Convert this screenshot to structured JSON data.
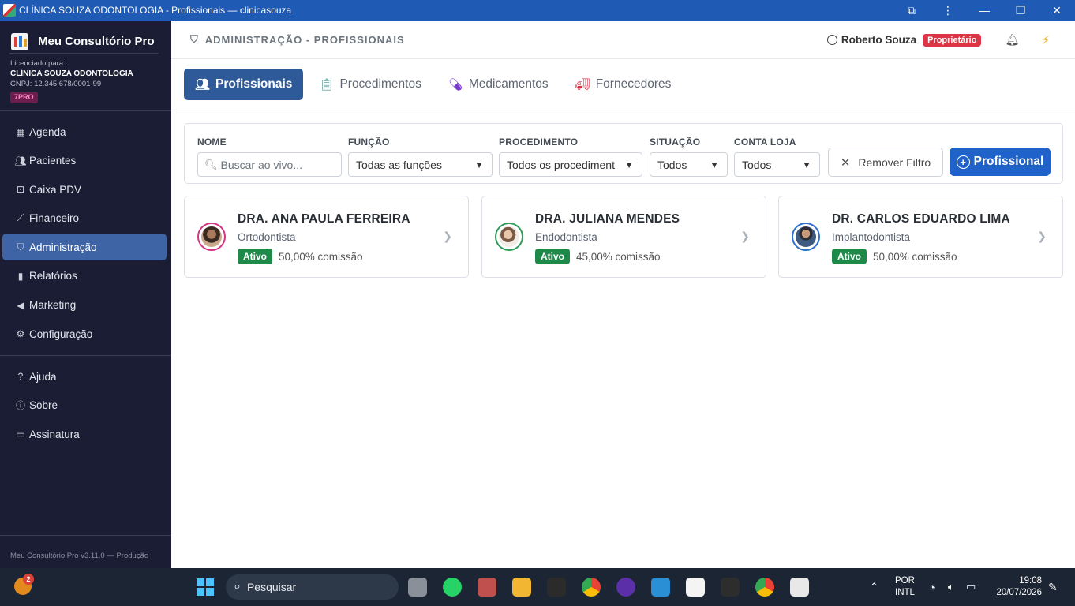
{
  "window": {
    "title": "CLÍNICA SOUZA ODONTOLOGIA - Profissionais — clinicasouza"
  },
  "sidebar": {
    "app_name": "Meu Consultório Pro",
    "license_label": "Licenciado para:",
    "clinic_name": "CLÍNICA SOUZA ODONTOLOGIA",
    "cnpj": "CNPJ: 12.345.678/0001-99",
    "plan_badge": "7PRO",
    "items": [
      {
        "label": "Agenda",
        "icon": "calendar-icon"
      },
      {
        "label": "Pacientes",
        "icon": "users-icon"
      },
      {
        "label": "Caixa PDV",
        "icon": "cash-register-icon"
      },
      {
        "label": "Financeiro",
        "icon": "chart-line-icon"
      },
      {
        "label": "Administração",
        "icon": "shield-icon",
        "active": true
      },
      {
        "label": "Relatórios",
        "icon": "bar-chart-icon"
      },
      {
        "label": "Marketing",
        "icon": "megaphone-icon"
      },
      {
        "label": "Configuração",
        "icon": "gear-icon"
      }
    ],
    "secondary_items": [
      {
        "label": "Ajuda",
        "icon": "help-icon"
      },
      {
        "label": "Sobre",
        "icon": "info-icon"
      },
      {
        "label": "Assinatura",
        "icon": "credit-card-icon"
      }
    ],
    "version": "Meu Consultório Pro v3.11.0 — Produção"
  },
  "header": {
    "breadcrumb": "ADMINISTRAÇÃO - PROFISSIONAIS",
    "user_name": "Roberto Souza",
    "user_role": "Proprietário"
  },
  "tabs": [
    {
      "label": "Profissionais",
      "icon": "users-icon",
      "active": true
    },
    {
      "label": "Procedimentos",
      "icon": "clipboard-pulse-icon"
    },
    {
      "label": "Medicamentos",
      "icon": "pill-icon"
    },
    {
      "label": "Fornecedores",
      "icon": "truck-icon"
    }
  ],
  "filters": {
    "name_label": "NOME",
    "name_placeholder": "Buscar ao vivo...",
    "role_label": "FUNÇÃO",
    "role_value": "Todas as funções",
    "procedure_label": "PROCEDIMENTO",
    "procedure_value": "Todos os procediment",
    "status_label": "SITUAÇÃO",
    "status_value": "Todos",
    "store_label": "CONTA LOJA",
    "store_value": "Todos",
    "remove_filter": "Remover Filtro",
    "add_professional": "Profissional"
  },
  "professionals": [
    {
      "name": "DRA. ANA PAULA FERREIRA",
      "specialty": "Ortodontista",
      "status": "Ativo",
      "commission": "50,00% comissão",
      "ring_color": "#d63384"
    },
    {
      "name": "DRA. JULIANA MENDES",
      "specialty": "Endodontista",
      "status": "Ativo",
      "commission": "45,00% comissão",
      "ring_color": "#2e9d5a"
    },
    {
      "name": "DR. CARLOS EDUARDO LIMA",
      "specialty": "Implantodontista",
      "status": "Ativo",
      "commission": "50,00% comissão",
      "ring_color": "#2f6fd0"
    }
  ],
  "taskbar": {
    "weather_badge": "2",
    "search_label": "Pesquisar",
    "language_line1": "POR",
    "language_line2": "INTL",
    "time": "19:08",
    "date": "20/07/2026"
  }
}
